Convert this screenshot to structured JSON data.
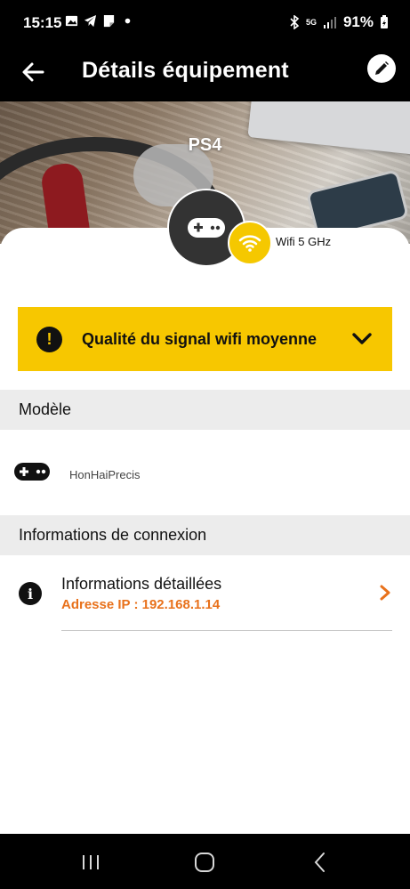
{
  "status_bar": {
    "time": "15:15",
    "battery": "91%",
    "network": "5G"
  },
  "app_bar": {
    "title": "Détails équipement",
    "back_icon": "arrow-left-icon",
    "edit_icon": "pencil-icon"
  },
  "device": {
    "name": "PS4",
    "type_icon": "gamepad-icon",
    "connection_label": "Wifi 5 GHz",
    "connection_icon": "wifi-icon"
  },
  "alert": {
    "message": "Qualité du signal wifi moyenne",
    "icon": "exclamation-icon",
    "expand_icon": "chevron-down-icon",
    "color": "#F7C700"
  },
  "sections": {
    "model": {
      "title": "Modèle",
      "value": "HonHaiPrecis"
    },
    "connection": {
      "title": "Informations de connexion",
      "item_title": "Informations détaillées",
      "item_subtitle": "Adresse IP : 192.168.1.14",
      "subtitle_color": "#E8711B"
    }
  },
  "nav_bar": {
    "recents_icon": "recents-icon",
    "home_icon": "home-icon",
    "back_icon": "back-icon"
  }
}
